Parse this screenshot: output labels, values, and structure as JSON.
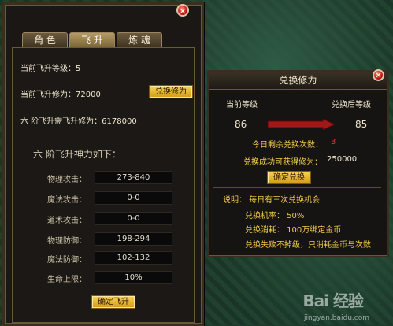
{
  "tabs": [
    "角 色",
    "飞 升",
    "炼 魂"
  ],
  "main": {
    "current_level_label": "当前飞升等级：5",
    "current_power_label": "当前飞升修为：72000",
    "exchange_button": "兑换修为",
    "six_stage_need": "六 阶飞升需飞升修为：6178000",
    "six_stage_heading": "六 阶飞升神力如下：",
    "stats": [
      {
        "name": "物理攻击：",
        "value": "273-840"
      },
      {
        "name": "魔法攻击：",
        "value": "0-0"
      },
      {
        "name": "道术攻击：",
        "value": "0-0"
      },
      {
        "name": "物理防御：",
        "value": "198-294"
      },
      {
        "name": "魔法防御：",
        "value": "102-132"
      },
      {
        "name": "生命上限：",
        "value": "10%"
      }
    ],
    "confirm_button": "确定飞升"
  },
  "dialog": {
    "title": "兑换修为",
    "current_level_label": "当前等级",
    "after_level_label": "兑换后等级",
    "current_level": "86",
    "after_level": "85",
    "remaining_label": "今日剩余兑换次数：",
    "remaining_count": "3",
    "gain_label": "兑换成功可获得修为：",
    "gain_value": "250000",
    "confirm_button": "确定兑换",
    "notes": [
      "说明：  每日有三次兑换机会",
      "兑换机率：  50%",
      "兑换消耗：  100万绑定金币",
      "兑换失败不掉级，只消耗金币与次数"
    ]
  },
  "watermark": {
    "logo": "Bai 经验",
    "url": "jingyan.baidu.com"
  },
  "colors": {
    "gold": "#f2c94c",
    "remaining_count": "#e03a2a",
    "arrow": "#a01818"
  }
}
